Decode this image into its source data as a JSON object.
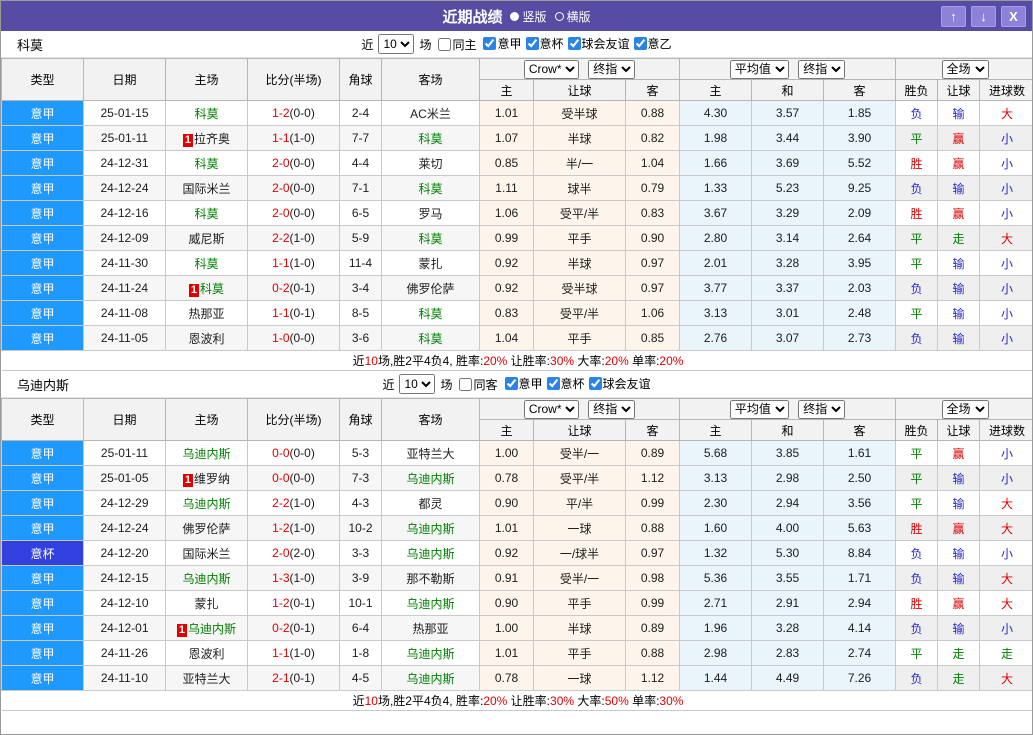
{
  "titlebar": {
    "title": "近期战绩",
    "radios": [
      {
        "label": "竖版",
        "selected": true
      },
      {
        "label": "横版",
        "selected": false
      }
    ],
    "buttons": [
      {
        "icon": "up-arrow-icon",
        "glyph": "↑"
      },
      {
        "icon": "down-arrow-icon",
        "glyph": "↓"
      },
      {
        "icon": "close-icon",
        "glyph": "X"
      }
    ]
  },
  "header": {
    "type": "类型",
    "date": "日期",
    "home": "主场",
    "score_half": "比分(半场)",
    "corner": "角球",
    "away": "客场",
    "dd_crow": "Crow*",
    "dd_final": "终指",
    "dd_avg": "平均值",
    "dd_full": "全场",
    "sub_home": "主",
    "sub_handicap": "让球",
    "sub_away": "客",
    "sub_home2": "主",
    "sub_draw": "和",
    "sub_away2": "客",
    "sub_wdl": "胜负",
    "sub_handicap2": "让球",
    "sub_goals": "进球数"
  },
  "colors": {
    "titlebar": "#564CA3",
    "league_serie": "#1E9AFE",
    "league_cup": "#3240E0",
    "win": "#E10000",
    "draw": "#008000",
    "lose": "#2626CC",
    "focus_team": "#008000",
    "score": "#E10000",
    "handicap_col_bg": "#FDF5EB",
    "avg_col_bg": "#E9F4FB"
  },
  "sections": [
    {
      "team": "科莫",
      "filter": {
        "near_label": "近",
        "count": "10",
        "games_label": "场",
        "same_label": "同主",
        "leagues": [
          "意甲",
          "意杯",
          "球会友谊",
          "意乙"
        ]
      },
      "rows": [
        {
          "league": "意甲",
          "date": "25-01-15",
          "home": "科莫",
          "home_focus": true,
          "home_badge": false,
          "score": "1-2",
          "half": "(0-0)",
          "corner": "2-4",
          "away": "AC米兰",
          "away_focus": false,
          "odds": [
            "1.01",
            "受半球",
            "0.88",
            "4.30",
            "3.57",
            "1.85"
          ],
          "res": [
            "负",
            "输",
            "大"
          ]
        },
        {
          "league": "意甲",
          "date": "25-01-11",
          "home": "拉齐奥",
          "home_focus": false,
          "home_badge": true,
          "score": "1-1",
          "half": "(1-0)",
          "corner": "7-7",
          "away": "科莫",
          "away_focus": true,
          "odds": [
            "1.07",
            "半球",
            "0.82",
            "1.98",
            "3.44",
            "3.90"
          ],
          "res": [
            "平",
            "赢",
            "小"
          ]
        },
        {
          "league": "意甲",
          "date": "24-12-31",
          "home": "科莫",
          "home_focus": true,
          "home_badge": false,
          "score": "2-0",
          "half": "(0-0)",
          "corner": "4-4",
          "away": "莱切",
          "away_focus": false,
          "odds": [
            "0.85",
            "半/一",
            "1.04",
            "1.66",
            "3.69",
            "5.52"
          ],
          "res": [
            "胜",
            "赢",
            "小"
          ]
        },
        {
          "league": "意甲",
          "date": "24-12-24",
          "home": "国际米兰",
          "home_focus": false,
          "home_badge": false,
          "score": "2-0",
          "half": "(0-0)",
          "corner": "7-1",
          "away": "科莫",
          "away_focus": true,
          "odds": [
            "1.11",
            "球半",
            "0.79",
            "1.33",
            "5.23",
            "9.25"
          ],
          "res": [
            "负",
            "输",
            "小"
          ]
        },
        {
          "league": "意甲",
          "date": "24-12-16",
          "home": "科莫",
          "home_focus": true,
          "home_badge": false,
          "score": "2-0",
          "half": "(0-0)",
          "corner": "6-5",
          "away": "罗马",
          "away_focus": false,
          "odds": [
            "1.06",
            "受平/半",
            "0.83",
            "3.67",
            "3.29",
            "2.09"
          ],
          "res": [
            "胜",
            "赢",
            "小"
          ]
        },
        {
          "league": "意甲",
          "date": "24-12-09",
          "home": "威尼斯",
          "home_focus": false,
          "home_badge": false,
          "score": "2-2",
          "half": "(1-0)",
          "corner": "5-9",
          "away": "科莫",
          "away_focus": true,
          "odds": [
            "0.99",
            "平手",
            "0.90",
            "2.80",
            "3.14",
            "2.64"
          ],
          "res": [
            "平",
            "走",
            "大"
          ]
        },
        {
          "league": "意甲",
          "date": "24-11-30",
          "home": "科莫",
          "home_focus": true,
          "home_badge": false,
          "score": "1-1",
          "half": "(1-0)",
          "corner": "11-4",
          "away": "蒙扎",
          "away_focus": false,
          "odds": [
            "0.92",
            "半球",
            "0.97",
            "2.01",
            "3.28",
            "3.95"
          ],
          "res": [
            "平",
            "输",
            "小"
          ]
        },
        {
          "league": "意甲",
          "date": "24-11-24",
          "home": "科莫",
          "home_focus": true,
          "home_badge": true,
          "score": "0-2",
          "half": "(0-1)",
          "corner": "3-4",
          "away": "佛罗伦萨",
          "away_focus": false,
          "odds": [
            "0.92",
            "受半球",
            "0.97",
            "3.77",
            "3.37",
            "2.03"
          ],
          "res": [
            "负",
            "输",
            "小"
          ]
        },
        {
          "league": "意甲",
          "date": "24-11-08",
          "home": "热那亚",
          "home_focus": false,
          "home_badge": false,
          "score": "1-1",
          "half": "(0-1)",
          "corner": "8-5",
          "away": "科莫",
          "away_focus": true,
          "odds": [
            "0.83",
            "受平/半",
            "1.06",
            "3.13",
            "3.01",
            "2.48"
          ],
          "res": [
            "平",
            "输",
            "小"
          ]
        },
        {
          "league": "意甲",
          "date": "24-11-05",
          "home": "恩波利",
          "home_focus": false,
          "home_badge": false,
          "score": "1-0",
          "half": "(0-0)",
          "corner": "3-6",
          "away": "科莫",
          "away_focus": true,
          "odds": [
            "1.04",
            "平手",
            "0.85",
            "2.76",
            "3.07",
            "2.73"
          ],
          "res": [
            "负",
            "输",
            "小"
          ]
        }
      ],
      "summary": [
        {
          "t": "近"
        },
        {
          "t": "10",
          "r": true
        },
        {
          "t": "场,胜2平4负4, 胜率:"
        },
        {
          "t": "20%",
          "r": true
        },
        {
          "t": " 让胜率:"
        },
        {
          "t": "30%",
          "r": true
        },
        {
          "t": " 大率:"
        },
        {
          "t": "20%",
          "r": true
        },
        {
          "t": " 单率:"
        },
        {
          "t": "20%",
          "r": true
        }
      ]
    },
    {
      "team": "乌迪内斯",
      "filter": {
        "near_label": "近",
        "count": "10",
        "games_label": "场",
        "same_label": "同客",
        "leagues": [
          "意甲",
          "意杯",
          "球会友谊"
        ]
      },
      "rows": [
        {
          "league": "意甲",
          "date": "25-01-11",
          "home": "乌迪内斯",
          "home_focus": true,
          "home_badge": false,
          "score": "0-0",
          "half": "(0-0)",
          "corner": "5-3",
          "away": "亚特兰大",
          "away_focus": false,
          "odds": [
            "1.00",
            "受半/一",
            "0.89",
            "5.68",
            "3.85",
            "1.61"
          ],
          "res": [
            "平",
            "赢",
            "小"
          ]
        },
        {
          "league": "意甲",
          "date": "25-01-05",
          "home": "维罗纳",
          "home_focus": false,
          "home_badge": true,
          "score": "0-0",
          "half": "(0-0)",
          "corner": "7-3",
          "away": "乌迪内斯",
          "away_focus": true,
          "odds": [
            "0.78",
            "受平/半",
            "1.12",
            "3.13",
            "2.98",
            "2.50"
          ],
          "res": [
            "平",
            "输",
            "小"
          ]
        },
        {
          "league": "意甲",
          "date": "24-12-29",
          "home": "乌迪内斯",
          "home_focus": true,
          "home_badge": false,
          "score": "2-2",
          "half": "(1-0)",
          "corner": "4-3",
          "away": "都灵",
          "away_focus": false,
          "odds": [
            "0.90",
            "平/半",
            "0.99",
            "2.30",
            "2.94",
            "3.56"
          ],
          "res": [
            "平",
            "输",
            "大"
          ]
        },
        {
          "league": "意甲",
          "date": "24-12-24",
          "home": "佛罗伦萨",
          "home_focus": false,
          "home_badge": false,
          "score": "1-2",
          "half": "(1-0)",
          "corner": "10-2",
          "away": "乌迪内斯",
          "away_focus": true,
          "odds": [
            "1.01",
            "一球",
            "0.88",
            "1.60",
            "4.00",
            "5.63"
          ],
          "res": [
            "胜",
            "赢",
            "大"
          ]
        },
        {
          "league": "意杯",
          "date": "24-12-20",
          "home": "国际米兰",
          "home_focus": false,
          "home_badge": false,
          "score": "2-0",
          "half": "(2-0)",
          "corner": "3-3",
          "away": "乌迪内斯",
          "away_focus": true,
          "odds": [
            "0.92",
            "一/球半",
            "0.97",
            "1.32",
            "5.30",
            "8.84"
          ],
          "res": [
            "负",
            "输",
            "小"
          ]
        },
        {
          "league": "意甲",
          "date": "24-12-15",
          "home": "乌迪内斯",
          "home_focus": true,
          "home_badge": false,
          "score": "1-3",
          "half": "(1-0)",
          "corner": "3-9",
          "away": "那不勒斯",
          "away_focus": false,
          "odds": [
            "0.91",
            "受半/一",
            "0.98",
            "5.36",
            "3.55",
            "1.71"
          ],
          "res": [
            "负",
            "输",
            "大"
          ]
        },
        {
          "league": "意甲",
          "date": "24-12-10",
          "home": "蒙扎",
          "home_focus": false,
          "home_badge": false,
          "score": "1-2",
          "half": "(0-1)",
          "corner": "10-1",
          "away": "乌迪内斯",
          "away_focus": true,
          "odds": [
            "0.90",
            "平手",
            "0.99",
            "2.71",
            "2.91",
            "2.94"
          ],
          "res": [
            "胜",
            "赢",
            "大"
          ]
        },
        {
          "league": "意甲",
          "date": "24-12-01",
          "home": "乌迪内斯",
          "home_focus": true,
          "home_badge": true,
          "score": "0-2",
          "half": "(0-1)",
          "corner": "6-4",
          "away": "热那亚",
          "away_focus": false,
          "odds": [
            "1.00",
            "半球",
            "0.89",
            "1.96",
            "3.28",
            "4.14"
          ],
          "res": [
            "负",
            "输",
            "小"
          ]
        },
        {
          "league": "意甲",
          "date": "24-11-26",
          "home": "恩波利",
          "home_focus": false,
          "home_badge": false,
          "score": "1-1",
          "half": "(1-0)",
          "corner": "1-8",
          "away": "乌迪内斯",
          "away_focus": true,
          "odds": [
            "1.01",
            "平手",
            "0.88",
            "2.98",
            "2.83",
            "2.74"
          ],
          "res": [
            "平",
            "走",
            "走"
          ]
        },
        {
          "league": "意甲",
          "date": "24-11-10",
          "home": "亚特兰大",
          "home_focus": false,
          "home_badge": false,
          "score": "2-1",
          "half": "(0-1)",
          "corner": "4-5",
          "away": "乌迪内斯",
          "away_focus": true,
          "odds": [
            "0.78",
            "一球",
            "1.12",
            "1.44",
            "4.49",
            "7.26"
          ],
          "res": [
            "负",
            "走",
            "大"
          ]
        }
      ],
      "summary": [
        {
          "t": "近"
        },
        {
          "t": "10",
          "r": true
        },
        {
          "t": "场,胜2平4负4, 胜率:"
        },
        {
          "t": "20%",
          "r": true
        },
        {
          "t": " 让胜率:"
        },
        {
          "t": "30%",
          "r": true
        },
        {
          "t": " 大率:"
        },
        {
          "t": "50%",
          "r": true
        },
        {
          "t": " 单率:"
        },
        {
          "t": "30%",
          "r": true
        }
      ]
    }
  ]
}
